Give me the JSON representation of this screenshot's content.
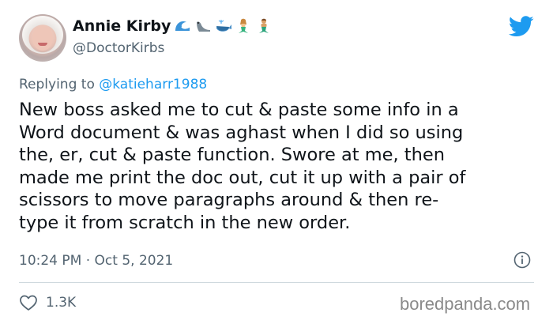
{
  "tweet": {
    "author_name": "Annie Kirby",
    "author_handle": "@DoctorKirbs",
    "name_emojis": [
      "wave-icon",
      "seal-icon",
      "whale-icon",
      "mermaid-icon",
      "merman-icon"
    ],
    "replying_prefix": "Replying to",
    "replying_to": "@katieharr1988",
    "text_lines": [
      "New boss asked me to cut & paste some info in a",
      "Word document & was aghast when I did so using",
      "the, er, cut & paste function. Swore at me, then",
      "made me print the doc out, cut it up with a pair of",
      "scissors to move paragraphs around & then re-",
      "type it from scratch in the new order."
    ],
    "timestamp": "10:24 PM · Oct 5, 2021",
    "like_count": "1.3K"
  },
  "colors": {
    "text": "#0f1419",
    "secondary": "#536471",
    "accent": "#1d9bf0",
    "divider": "#cfd9de"
  },
  "watermark": "boredpanda.com"
}
